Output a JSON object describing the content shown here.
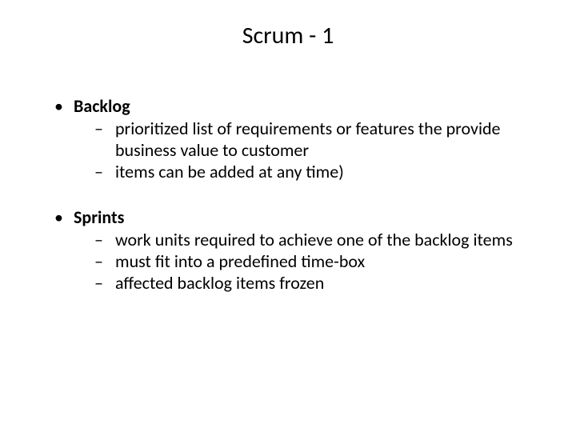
{
  "title": "Scrum - 1",
  "bullet": "•",
  "dash": "–",
  "sections": [
    {
      "heading": "Backlog",
      "items": [
        "prioritized list of requirements or features the provide business value to customer",
        "items can be added at any time)"
      ]
    },
    {
      "heading": "Sprints",
      "items": [
        "work units required to achieve one of the backlog items",
        "must fit into a predefined time-box",
        "affected backlog items frozen"
      ]
    }
  ]
}
